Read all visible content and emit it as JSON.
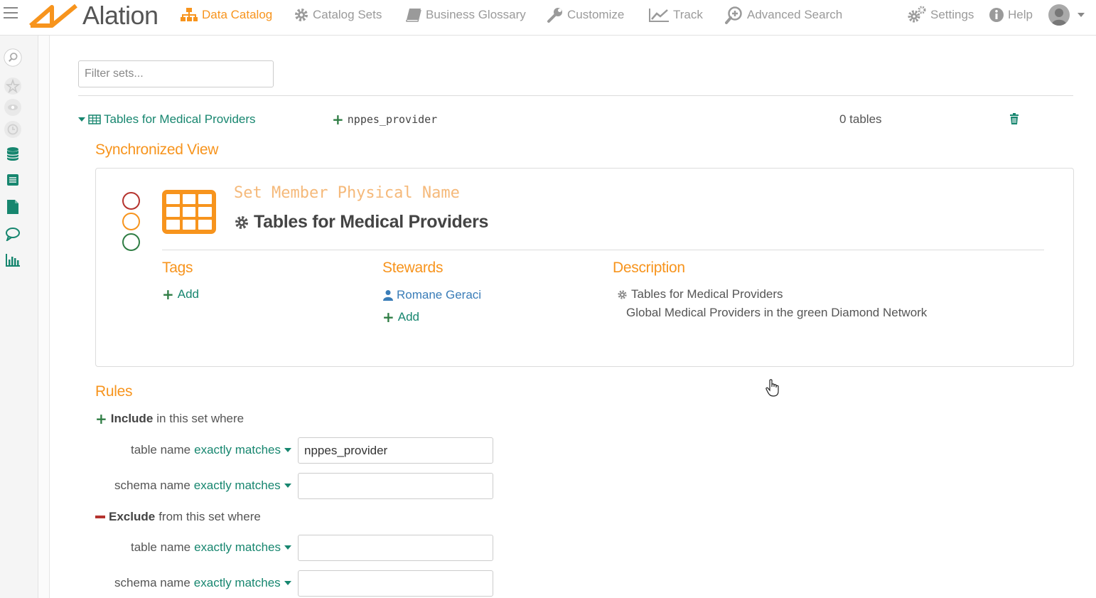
{
  "app": {
    "name": "Alation"
  },
  "nav": {
    "data_catalog": "Data Catalog",
    "catalog_sets": "Catalog Sets",
    "business_glossary": "Business Glossary",
    "customize": "Customize",
    "track": "Track",
    "advanced_search": "Advanced Search",
    "settings": "Settings",
    "help": "Help"
  },
  "filter": {
    "placeholder": "Filter sets..."
  },
  "set": {
    "title": "Tables for Medical Providers",
    "rule_summary": "nppes_provider",
    "count": "0 tables"
  },
  "synchronized_view": {
    "heading": "Synchronized View",
    "physical_name": "Set Member Physical Name",
    "object_title": "Tables for Medical Providers",
    "tags": {
      "heading": "Tags",
      "add_label": "Add"
    },
    "stewards": {
      "heading": "Stewards",
      "steward_name": "Romane Geraci",
      "add_label": "Add"
    },
    "description": {
      "heading": "Description",
      "title": "Tables for Medical Providers",
      "text": "Global Medical Providers in the green Diamond Network"
    },
    "status_colors": {
      "red": "#b5332e",
      "orange": "#f7941d",
      "green": "#2f7d44"
    }
  },
  "rules": {
    "heading": "Rules",
    "include": {
      "keyword": "Include",
      "rest": "in this set where"
    },
    "exclude": {
      "keyword": "Exclude",
      "rest": "from this set where"
    },
    "table_name_label": "table name",
    "schema_name_label": "schema name",
    "match_option": "exactly matches",
    "include_table_value": "nppes_provider",
    "include_schema_value": "",
    "exclude_table_value": "",
    "exclude_schema_value": ""
  },
  "colors": {
    "accent": "#f7941d",
    "link": "#17866f",
    "steward": "#3a7db8"
  }
}
